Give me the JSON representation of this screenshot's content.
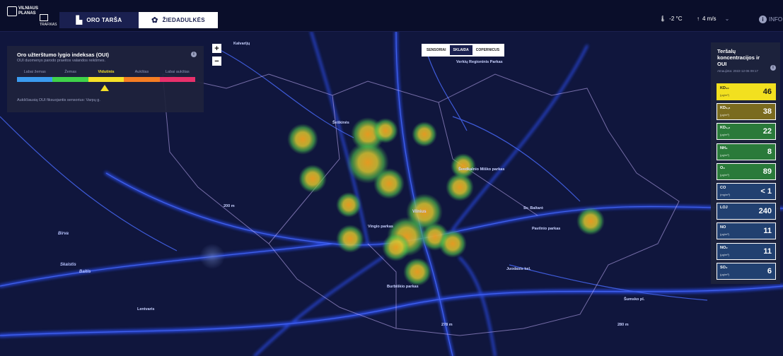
{
  "header": {
    "logo_line1": "VILNIAUS",
    "logo_line2": "PLANAS",
    "logo_sub": "TRAFIKAS",
    "tabs": [
      {
        "label": "ORO TARŠA",
        "icon": "factory-icon",
        "active": false
      },
      {
        "label": "ŽIEDADULKĖS",
        "icon": "pollen-icon",
        "active": true
      }
    ],
    "temperature": "-2 °C",
    "wind": "4 m/s",
    "info_label": "INFO"
  },
  "aqi_panel": {
    "title": "Oro užterštumo lygio indeksas (OUI)",
    "subtitle": "OUI duomenys parodo praeitos valandos reikšmes.",
    "levels": [
      "Labai žemas",
      "Žemas",
      "Vidutinis",
      "Aukštas",
      "Labai aukštas"
    ],
    "colors": [
      "#3b9bf0",
      "#3fd24a",
      "#f5e028",
      "#f57d23",
      "#e8306b"
    ],
    "active_level": "Vidutinis",
    "note": "Aukščiausią OUI fiksuojantis sensorius: Varpų g."
  },
  "map_controls": {
    "zoom_in": "+",
    "zoom_out": "−",
    "layers": [
      "SENSORIAI",
      "SKLAIDA",
      "COPERNICUS"
    ],
    "active_layer": "SKLAIDA"
  },
  "map_labels": [
    {
      "text": "Kalvarijų",
      "kind": "street"
    },
    {
      "text": "Verkių Regioninis Parkas",
      "kind": "park"
    },
    {
      "text": "Šeškinės",
      "kind": "street"
    },
    {
      "text": "Švedkalnio Miško parkas",
      "kind": "park"
    },
    {
      "text": "Vilnius",
      "kind": "city"
    },
    {
      "text": "Vingio parkas",
      "kind": "park"
    },
    {
      "text": "Pavilnio parkas",
      "kind": "park"
    },
    {
      "text": "Burbiškio parkas",
      "kind": "park"
    },
    {
      "text": "Birva",
      "kind": "area"
    },
    {
      "text": "Skaistis",
      "kind": "area"
    },
    {
      "text": "Baltis",
      "kind": "area"
    },
    {
      "text": "Lentvaris",
      "kind": "area"
    },
    {
      "text": "200 m",
      "kind": "elev"
    },
    {
      "text": "278 m",
      "kind": "elev"
    },
    {
      "text": "280 m",
      "kind": "elev"
    },
    {
      "text": "Šumsko pl.",
      "kind": "street"
    },
    {
      "text": "Juodasis kel.",
      "kind": "street"
    },
    {
      "text": "Sv. Baltarė",
      "kind": "street"
    }
  ],
  "pollutants_panel": {
    "title": "Teršalų koncentracijos ir OUI",
    "date": "Atnaujinta: 2022-12-06 09:17",
    "items": [
      {
        "name": "KD₁₀",
        "unit": "(µg/m³)",
        "value": "46",
        "bg": "#f2e01f",
        "fg": "#1a1a1a"
      },
      {
        "name": "KD₂,₅",
        "unit": "(µg/m³)",
        "value": "38",
        "bg": "#7a6b1f",
        "fg": "#ffffff"
      },
      {
        "name": "KD₁,₀",
        "unit": "(µg/m³)",
        "value": "22",
        "bg": "#2a7a3a",
        "fg": "#ffffff"
      },
      {
        "name": "NH₃",
        "unit": "(µg/m³)",
        "value": "8",
        "bg": "#2a7a3a",
        "fg": "#ffffff"
      },
      {
        "name": "O₃",
        "unit": "(µg/m³)",
        "value": "89",
        "bg": "#2a7a3a",
        "fg": "#ffffff"
      },
      {
        "name": "CO",
        "unit": "(mg/m³)",
        "value": "< 1",
        "bg": "#214070",
        "fg": "#ffffff"
      },
      {
        "name": "LOJ",
        "unit": "",
        "value": "240",
        "bg": "#214070",
        "fg": "#ffffff"
      },
      {
        "name": "NO",
        "unit": "(µg/m³)",
        "value": "11",
        "bg": "#214070",
        "fg": "#ffffff"
      },
      {
        "name": "NO₂",
        "unit": "(µg/m³)",
        "value": "11",
        "bg": "#214070",
        "fg": "#ffffff"
      },
      {
        "name": "SO₂",
        "unit": "(µg/m³)",
        "value": "6",
        "bg": "#214070",
        "fg": "#ffffff"
      }
    ]
  }
}
